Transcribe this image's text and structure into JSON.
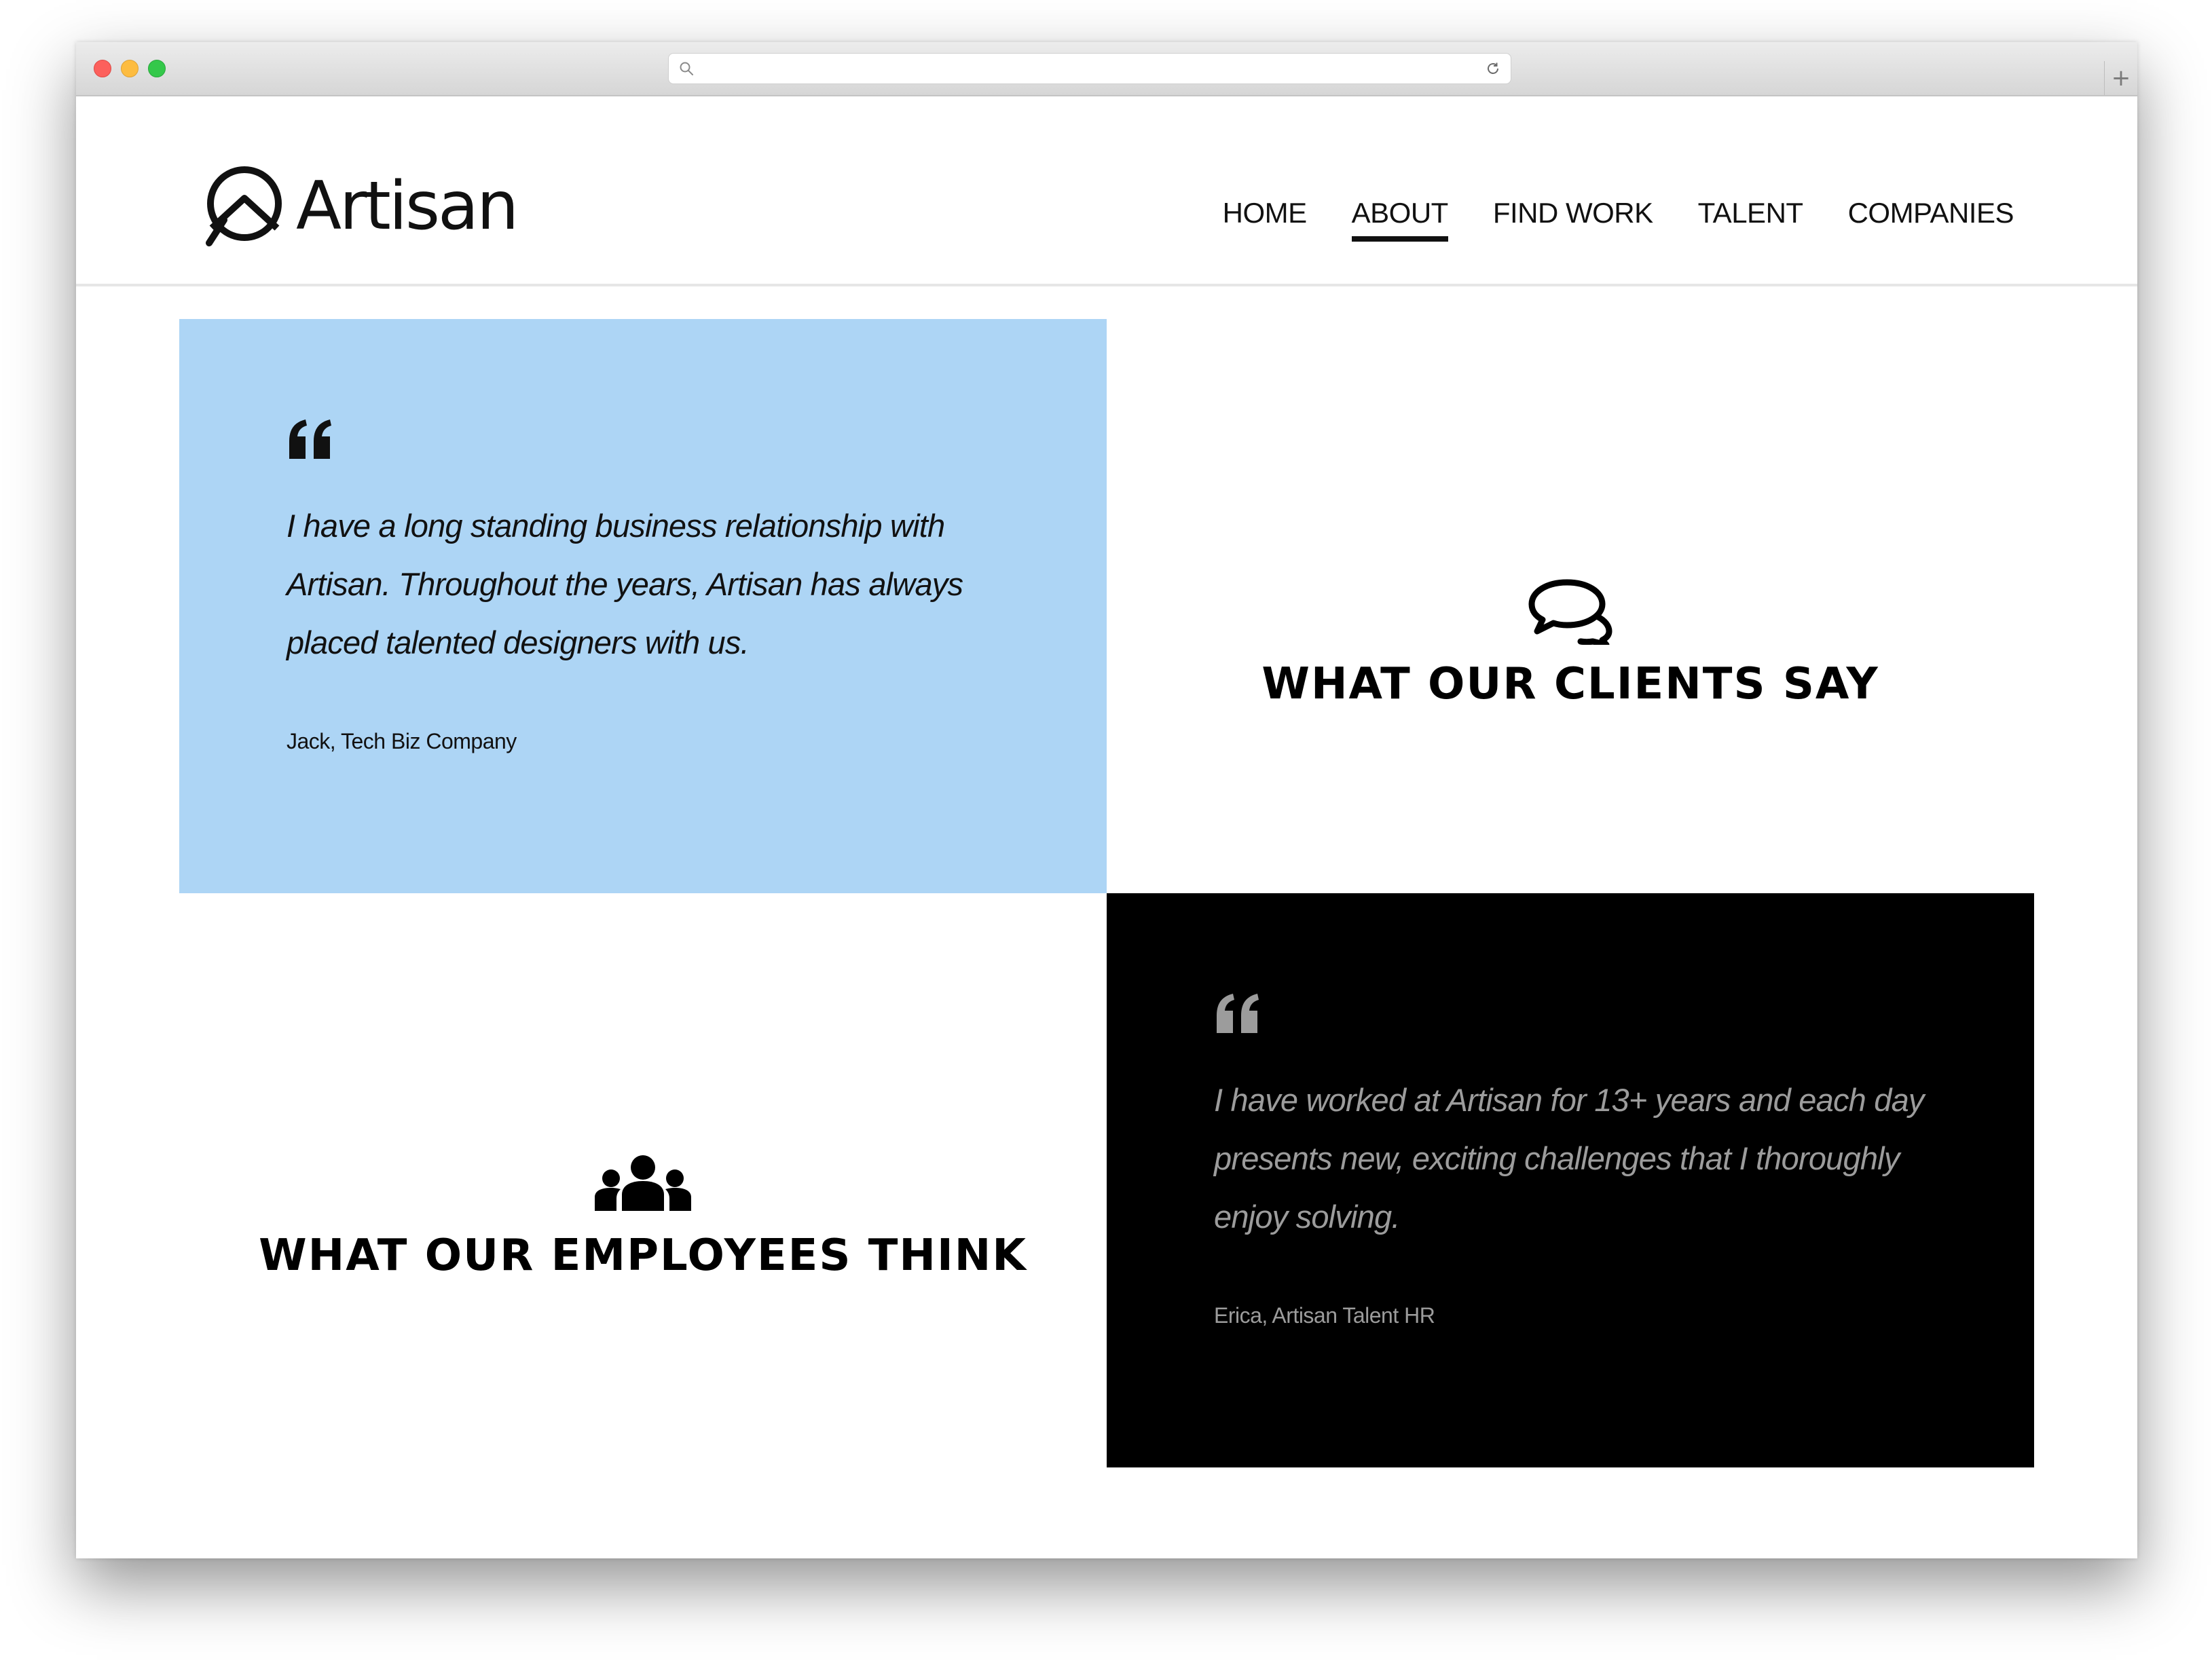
{
  "site": {
    "logo_text": "Artisan"
  },
  "nav": {
    "items": [
      {
        "label": "HOME"
      },
      {
        "label": "ABOUT"
      },
      {
        "label": "FIND WORK"
      },
      {
        "label": "TALENT"
      },
      {
        "label": "COMPANIES"
      }
    ],
    "active": "ABOUT"
  },
  "clients": {
    "quote": "I have a long standing business relationship with Artisan. Throughout the years, Artisan has always placed talented designers with us.",
    "author": "Jack, Tech Biz Company",
    "section_title": "WHAT OUR CLIENTS SAY",
    "icon": "speech-bubbles-icon"
  },
  "employees": {
    "quote": "I have worked at Artisan for 13+ years and each day presents new, exciting challenges that I thoroughly enjoy solving.",
    "author": "Erica, Artisan Talent HR",
    "section_title": "WHAT OUR EMPLOYEES THINK",
    "icon": "group-icon"
  },
  "colors": {
    "client_panel_bg": "#add5f5",
    "employee_panel_bg": "#000000",
    "employee_text": "#9c9c9c",
    "text_dark": "#111111"
  }
}
